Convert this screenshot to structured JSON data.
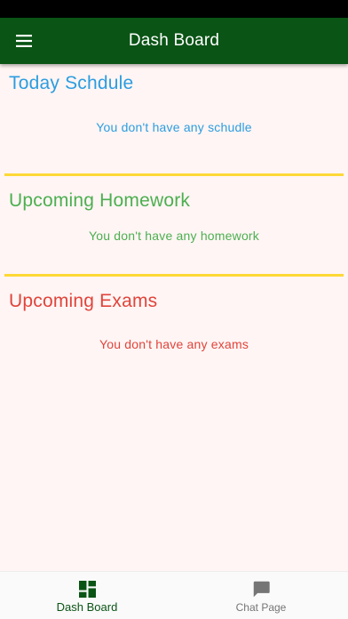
{
  "app_bar": {
    "title": "Dash Board",
    "menu_icon": "hamburger-menu-icon"
  },
  "sections": {
    "schedule": {
      "heading": "Today Schdule",
      "empty_message": "You don't have any schudle",
      "color": "#2c9de0"
    },
    "homework": {
      "heading": "Upcoming Homework",
      "empty_message": "You don't have any homework",
      "color": "#4caf50"
    },
    "exams": {
      "heading": "Upcoming Exams",
      "empty_message": "You don't have any exams",
      "color": "#e0443b"
    }
  },
  "bottom_nav": {
    "dashboard": {
      "label": "Dash Board",
      "icon": "dashboard-icon",
      "selected": true
    },
    "chat": {
      "label": "Chat Page",
      "icon": "chat-icon",
      "selected": false
    }
  },
  "colors": {
    "app_bar": "#0a5415",
    "background": "#fff5f4",
    "divider": "#fdd835",
    "nav_active": "#0a5415",
    "nav_inactive": "#757575"
  }
}
